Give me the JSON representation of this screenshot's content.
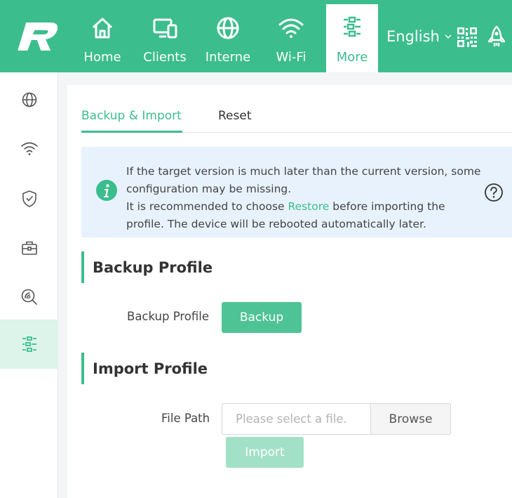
{
  "colors": {
    "brand": "#3cbd8e",
    "sidebar_active": "#dcf4ea",
    "notice_bg": "#e7f2fd",
    "import_disabled": "#a3e0c8"
  },
  "topnav": {
    "items": [
      {
        "label": "Home",
        "icon": "home-icon"
      },
      {
        "label": "Clients",
        "icon": "devices-icon"
      },
      {
        "label": "Interne",
        "icon": "globe-icon"
      },
      {
        "label": "Wi-Fi",
        "icon": "wifi-icon"
      },
      {
        "label": "More",
        "icon": "settings-sliders-icon",
        "active": true
      }
    ],
    "language": "English",
    "qr_icon": "qr-code-icon",
    "rocket_icon": "rocket-icon"
  },
  "sidebar": {
    "items": [
      {
        "icon": "globe-icon"
      },
      {
        "icon": "wifi-icon"
      },
      {
        "icon": "shield-check-icon"
      },
      {
        "icon": "toolbox-icon"
      },
      {
        "icon": "diagnostics-icon"
      },
      {
        "icon": "settings-sliders-icon",
        "active": true
      }
    ]
  },
  "tabs": {
    "backup_import": "Backup & Import",
    "reset": "Reset"
  },
  "notice": {
    "line1": "If the target version is much later than the current version, some",
    "line2": "configuration may be missing.",
    "line3_pre": "It is recommended to choose ",
    "line3_link": "Restore",
    "line3_post": " before importing the",
    "line4": "profile. The device will be rebooted automatically later."
  },
  "backup": {
    "section_title": "Backup Profile",
    "label": "Backup Profile",
    "button": "Backup"
  },
  "import": {
    "section_title": "Import Profile",
    "label": "File Path",
    "placeholder": "Please select a file.",
    "browse": "Browse",
    "button": "Import"
  }
}
